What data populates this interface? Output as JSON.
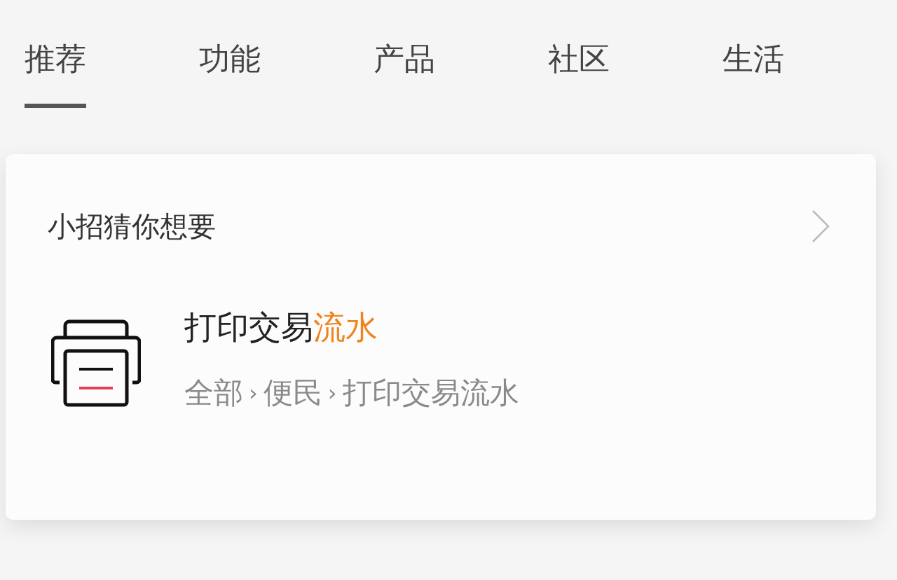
{
  "tabs": [
    {
      "label": "推荐",
      "selected": true
    },
    {
      "label": "功能",
      "selected": false
    },
    {
      "label": "产品",
      "selected": false
    },
    {
      "label": "社区",
      "selected": false
    },
    {
      "label": "生活",
      "selected": false
    }
  ],
  "card": {
    "title": "小招猜你想要",
    "result": {
      "title_parts": [
        {
          "text": "打印交易",
          "highlighted": false
        },
        {
          "text": "流水",
          "highlighted": true
        }
      ],
      "path_separator": "›",
      "path": [
        "全部",
        "便民",
        "打印交易流水"
      ]
    }
  }
}
